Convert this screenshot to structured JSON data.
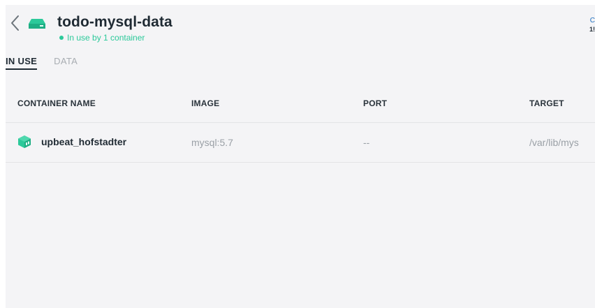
{
  "header": {
    "title": "todo-mysql-data",
    "status": "In use by 1 container",
    "corner_line1": "C",
    "corner_line2": "1!"
  },
  "tabs": [
    {
      "label": "IN USE",
      "active": true
    },
    {
      "label": "DATA",
      "active": false
    }
  ],
  "table": {
    "columns": [
      "CONTAINER NAME",
      "IMAGE",
      "PORT",
      "TARGET"
    ],
    "rows": [
      {
        "name": "upbeat_hofstadter",
        "image": "mysql:5.7",
        "port": "--",
        "target": "/var/lib/mys"
      }
    ]
  },
  "colors": {
    "accent": "#2cc99a",
    "text": "#1f2a33",
    "muted": "#9aa0a6",
    "background": "#f4f4f6"
  },
  "icons": {
    "back": "chevron-left-icon",
    "volume": "volume-icon",
    "container": "container-icon"
  }
}
